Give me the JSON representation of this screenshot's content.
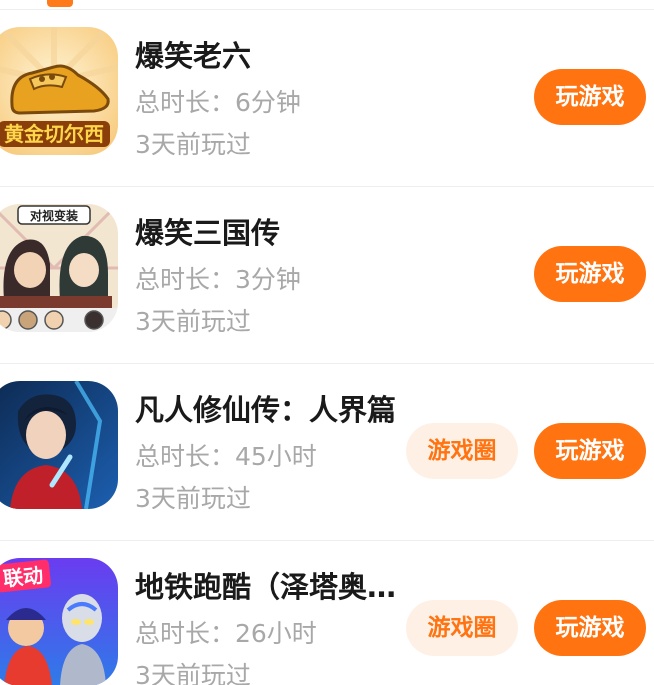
{
  "games": [
    {
      "title": "爆笑老六",
      "play_time": "总时长：6分钟",
      "last_played": "3天前玩过",
      "icon_name": "golden-shoe-icon",
      "icon_text": "黄金切尔西",
      "has_circle": false,
      "circle_label": "",
      "play_label": "玩游戏"
    },
    {
      "title": "爆笑三国传",
      "play_time": "总时长：3分钟",
      "last_played": "3天前玩过",
      "icon_name": "three-kingdoms-icon",
      "icon_text": "对视变装",
      "has_circle": false,
      "circle_label": "",
      "play_label": "玩游戏"
    },
    {
      "title": "凡人修仙传：人界篇",
      "play_time": "总时长：45小时",
      "last_played": "3天前玩过",
      "icon_name": "immortal-hero-icon",
      "icon_text": "",
      "has_circle": true,
      "circle_label": "游戏圈",
      "play_label": "玩游戏"
    },
    {
      "title": "地铁跑酷（泽塔奥特曼联动）",
      "play_time": "总时长：26小时",
      "last_played": "3天前玩过",
      "icon_name": "subway-surfers-icon",
      "icon_text": "联动",
      "has_circle": true,
      "circle_label": "游戏圈",
      "play_label": "玩游戏"
    }
  ],
  "colors": {
    "accent": "#ff7411",
    "accent_light": "#fff0e6",
    "secondary_text": "#a8a8a8",
    "title_text": "#1a1a1a"
  }
}
